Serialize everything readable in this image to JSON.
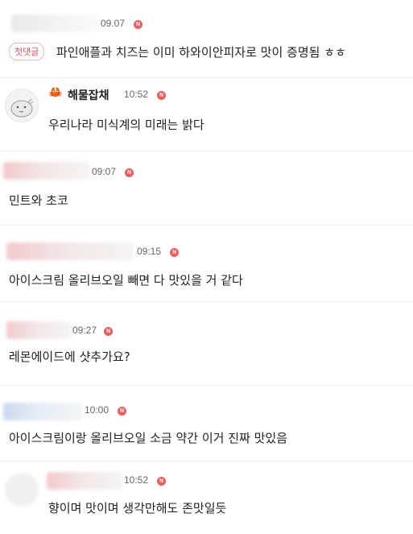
{
  "comments": [
    {
      "time": "09.07",
      "badge": "N",
      "tag": "첫댓글",
      "text": "파인애플과 치즈는 이미 하와이안피자로 맛이 증명됨 ㅎㅎ"
    },
    {
      "nickname": "해물잡채",
      "nick_icon": "🦀",
      "time": "10:52",
      "badge": "N",
      "text": "우리나라 미식계의 미래는 밝다"
    },
    {
      "time": "09:07",
      "badge": "N",
      "text": "민트와 초코"
    },
    {
      "time": "09:15",
      "badge": "N",
      "text": "아이스크림 올리브오일 빼면 다 맛있을 거 같다"
    },
    {
      "time": "09:27",
      "badge": "N",
      "text": "레몬에이드에 샷추가요?"
    },
    {
      "time": "10:00",
      "badge": "N",
      "text": "아이스크림이랑 올리브오일 소금 약간 이거 진짜 맛있음"
    },
    {
      "time": "10:52",
      "badge": "N",
      "text": "향이며 맛이며 생각만해도 존맛일듯"
    }
  ]
}
